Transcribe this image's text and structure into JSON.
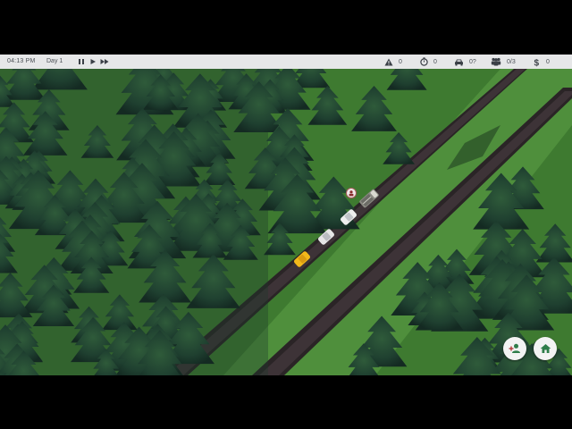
{
  "hud": {
    "time": "04:13 PM",
    "day": "Day 1",
    "controls": {
      "pause": "pause-icon",
      "play": "play-icon",
      "fast_forward": "fast-forward-icon"
    },
    "stats": {
      "alerts": {
        "icon": "warning-icon",
        "value": "0"
      },
      "timer": {
        "icon": "stopwatch-icon",
        "value": "0"
      },
      "vehicles": {
        "icon": "car-icon",
        "value": "0?"
      },
      "passengers": {
        "icon": "people-icon",
        "value": "0/3"
      },
      "money": {
        "icon": "dollar-icon",
        "value": "0"
      }
    }
  },
  "buttons": {
    "add_passenger": "add-person-icon",
    "home": "home-icon"
  },
  "colors": {
    "hud_bg": "#e6e7e8",
    "grass": "#3f7a33",
    "road": "#3d3337",
    "taxi": "#f2b81a",
    "button_green": "#2f7d4a"
  }
}
